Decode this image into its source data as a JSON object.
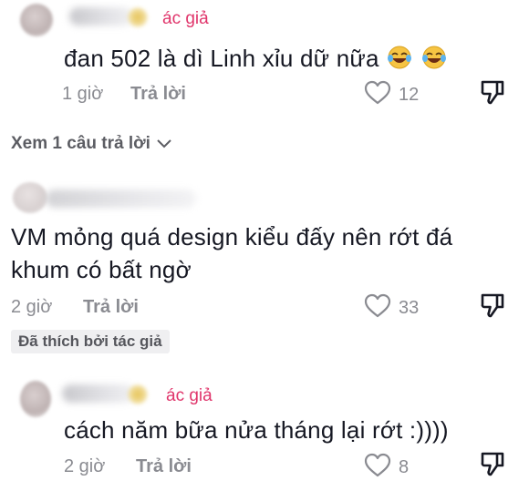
{
  "comments": [
    {
      "author_tag": "ác giả",
      "text": "đan 502 là dì Linh xỉu dữ nữa",
      "emoji_count": 2,
      "time": "1 giờ",
      "reply_label": "Trả lời",
      "likes": "12",
      "view_replies": "Xem 1 câu trả lời"
    },
    {
      "text_line1": "VM mỏng quá design kiểu đấy nên rớt đá",
      "text_line2": "khum có bất ngờ",
      "time": "2 giờ",
      "reply_label": "Trả lời",
      "likes": "33",
      "liked_by_author": "Đã thích bởi tác giả"
    },
    {
      "author_tag": "ác giả",
      "text": "cách năm bữa nửa tháng lại rớt :))))",
      "time": "2 giờ",
      "reply_label": "Trả lời",
      "likes": "8"
    }
  ],
  "colors": {
    "author_tag": "#e0356b",
    "meta": "#8a8b91",
    "text": "#161823"
  },
  "icons": [
    "heart-outline-icon",
    "dislike-icon",
    "chevron-down-icon",
    "laughing-emoji-icon"
  ]
}
